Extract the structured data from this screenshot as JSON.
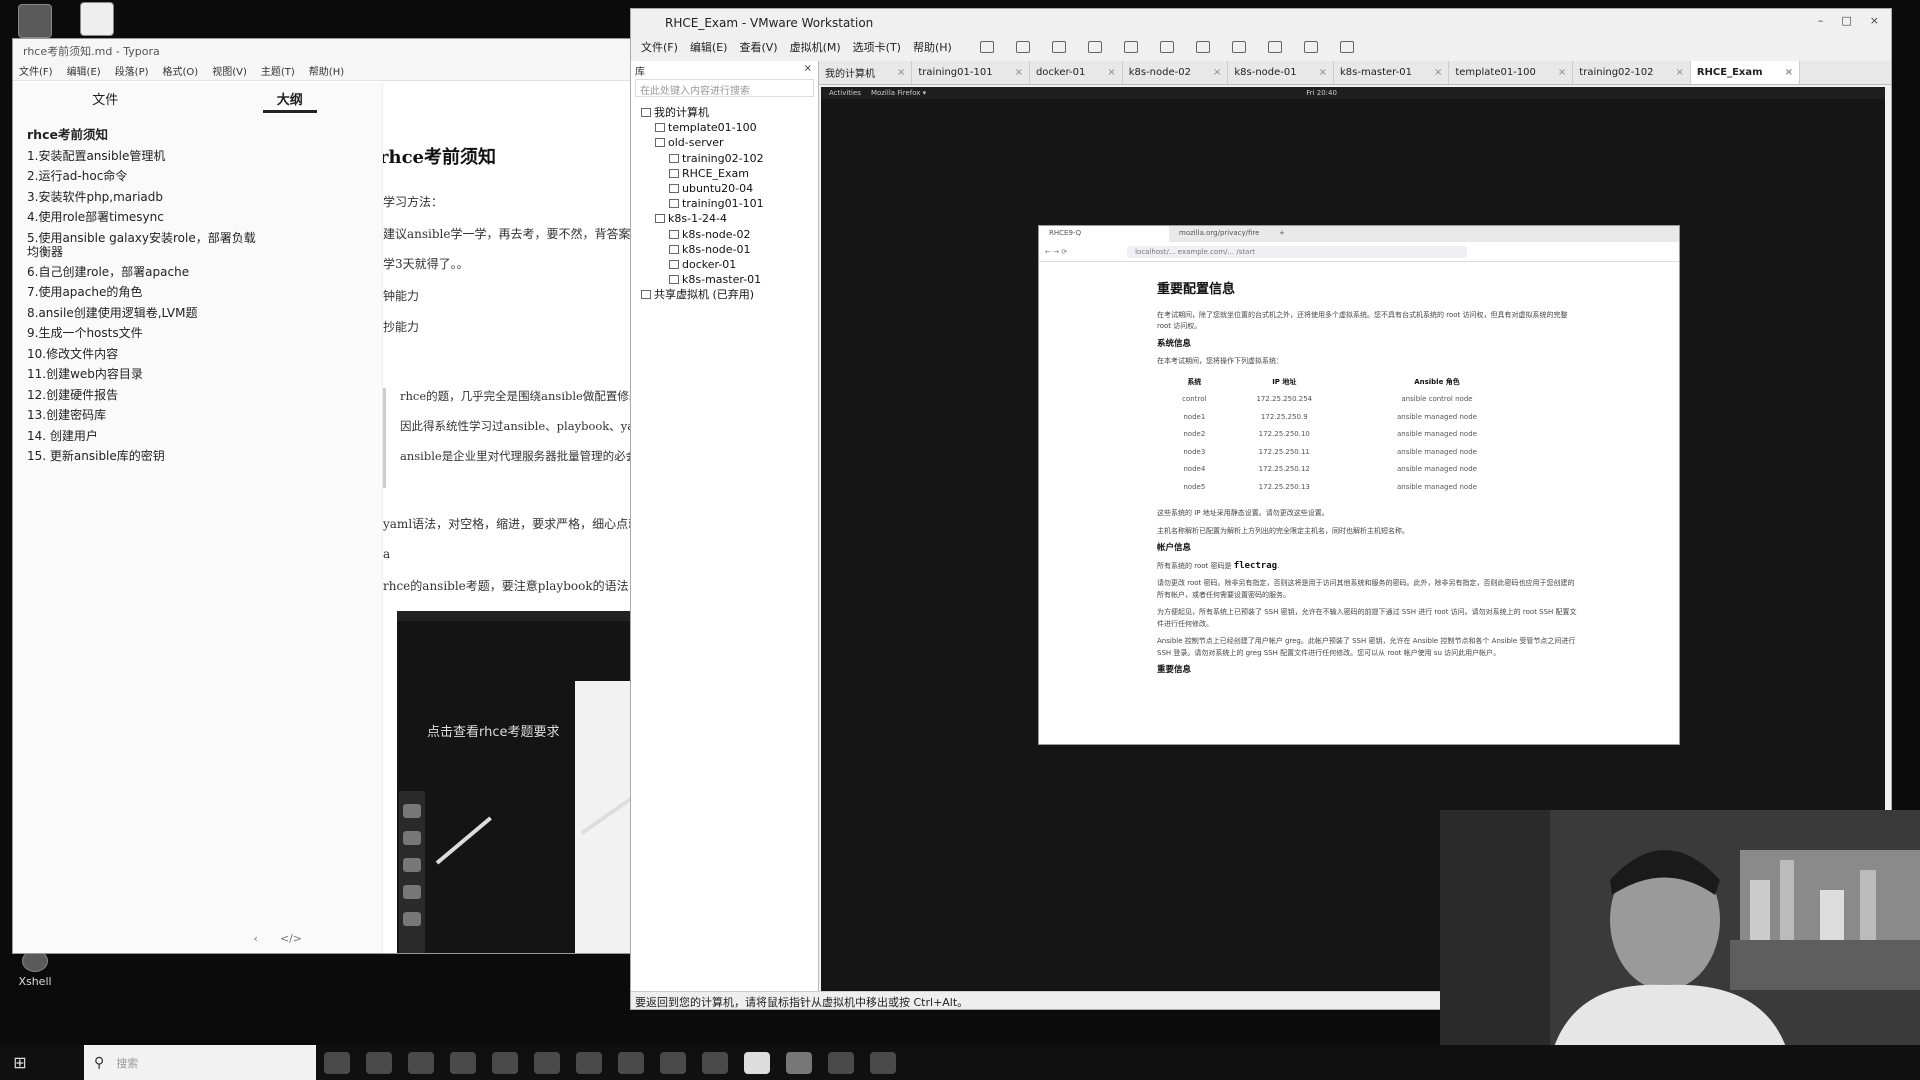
{
  "desktop": {
    "icons": [
      {
        "label": ""
      },
      {
        "label": ""
      },
      {
        "label": "Xshell"
      }
    ]
  },
  "typora": {
    "title": "rhce考前须知.md - Typora",
    "menu": [
      "文件(F)",
      "编辑(E)",
      "段落(P)",
      "格式(O)",
      "视图(V)",
      "主题(T)",
      "帮助(H)"
    ],
    "tabs": {
      "files": "文件",
      "outline": "大纲"
    },
    "outline": [
      "rhce考前须知",
      "1.安装配置ansible管理机",
      "2.运行ad-hoc命令",
      "3.安装软件php,mariadb",
      "4.使用role部署timesync",
      "5.使用ansible galaxy安装role，部署负载均衡器",
      "6.自己创建role，部署apache",
      "7.使用apache的角色",
      "8.ansile创建使用逻辑卷,LVM题",
      "9.生成一个hosts文件",
      "10.修改文件内容",
      "11.创建web内容目录",
      "12.创建硬件报告",
      "13.创建密码库",
      "14. 创建用户",
      "15. 更新ansible库的密钥"
    ],
    "footer": {
      "back": "‹",
      "source": "</>"
    },
    "editor": {
      "title": "rhce考前须知",
      "p1": "学习方法：",
      "p2": "建议ansible学一学，再去考，要不然，背答案，，",
      "p3": "学3天就得了。。",
      "p4": "钟能力",
      "p5": "抄能力",
      "bq1": "rhce的题，几乎完全是围绕ansible做配置修改",
      "bq2": "因此得系统性学习过ansible、playbook、yam",
      "bq3": "ansible是企业里对代理服务器批量管理的必会",
      "p6": "yaml语法，对空格，缩进，要求严格，细心点就",
      "p7": "a",
      "p8": "rhce的ansible考题，要注意playbook的语法，变量",
      "thumb_caption": "点击查看rhce考题要求"
    }
  },
  "vmware": {
    "title": "RHCE_Exam - VMware Workstation",
    "window_controls": [
      "–",
      "□",
      "×"
    ],
    "menu": [
      "文件(F)",
      "编辑(E)",
      "查看(V)",
      "虚拟机(M)",
      "选项卡(T)",
      "帮助(H)"
    ],
    "library": {
      "header": "库",
      "search_placeholder": "在此处键入内容进行搜索",
      "tree": [
        {
          "label": "我的计算机",
          "level": 0
        },
        {
          "label": "template01-100",
          "level": 1
        },
        {
          "label": "old-server",
          "level": 1
        },
        {
          "label": "training02-102",
          "level": 2
        },
        {
          "label": "RHCE_Exam",
          "level": 2
        },
        {
          "label": "ubuntu20-04",
          "level": 2
        },
        {
          "label": "training01-101",
          "level": 2
        },
        {
          "label": "k8s-1-24-4",
          "level": 1
        },
        {
          "label": "k8s-node-02",
          "level": 2
        },
        {
          "label": "k8s-node-01",
          "level": 2
        },
        {
          "label": "docker-01",
          "level": 2
        },
        {
          "label": "k8s-master-01",
          "level": 2
        },
        {
          "label": "共享虚拟机 (已弃用)",
          "level": 0
        }
      ]
    },
    "tabs": [
      "我的计算机",
      "training01-101",
      "docker-01",
      "k8s-node-02",
      "k8s-node-01",
      "k8s-master-01",
      "template01-100",
      "training02-102",
      "RHCE_Exam"
    ],
    "active_tab": "RHCE_Exam",
    "guest_bar": {
      "activities": "Activities",
      "app": "Mozilla Firefox ▾",
      "clock": "Fri 20:40"
    },
    "status": "要返回到您的计算机，请将鼠标指针从虚拟机中移出或按 Ctrl+Alt。"
  },
  "firefox": {
    "tabs": [
      "RHCE9-Q",
      "mozilla.org/privacy/fire",
      "+"
    ],
    "url": "localhost/... example.com/... /start",
    "doc": {
      "title": "重要配置信息",
      "intro": "在考试期间，除了您就坐位置的台式机之外，还将使用多个虚拟系统。您不具有台式机系统的 root 访问权，但具有对虚拟系统的完整 root 访问权。",
      "h_sys": "系统信息",
      "sys_intro": "在本考试期间，您将操作下列虚拟系统：",
      "table_headers": [
        "系统",
        "IP 地址",
        "Ansible 角色"
      ],
      "table_rows": [
        [
          "control",
          "172.25.250.254",
          "ansible control node"
        ],
        [
          "node1",
          "172.25.250.9",
          "ansible managed node"
        ],
        [
          "node2",
          "172.25.250.10",
          "ansible managed node"
        ],
        [
          "node3",
          "172.25.250.11",
          "ansible managed node"
        ],
        [
          "node4",
          "172.25.250.12",
          "ansible managed node"
        ],
        [
          "node5",
          "172.25.250.13",
          "ansible managed node"
        ]
      ],
      "note1": "这些系统的 IP 地址采用静态设置。请勿更改这些设置。",
      "note2": "主机名称解析已配置为解析上方列出的完全限定主机名，同时也解析主机短名称。",
      "h_acct": "帐户信息",
      "acct_prefix": "所有系统的 root 密码是",
      "acct_pw": "flectrag",
      "acct_p1": "请勿更改 root 密码。除非另有指定，否则这将是用于访问其他系统和服务的密码。此外，除非另有指定，否则此密码也应用于您创建的所有帐户，或者任何需要设置密码的服务。",
      "acct_p2": "为方便起见，所有系统上已预装了 SSH 密钥，允许在不输入密码的前提下通过 SSH 进行 root 访问。请勿对系统上的 root SSH 配置文件进行任何修改。",
      "acct_p3": "Ansible 控制节点上已经创建了用户帐户 greg。此帐户预装了 SSH 密钥，允许在 Ansible 控制节点和各个 Ansible 受管节点之间进行 SSH 登录。请勿对系统上的 greg SSH 配置文件进行任何修改。您可以从 root 帐户使用 su 访问此用户帐户。",
      "h_more": "重要信息"
    }
  },
  "taskbar": {
    "start": "⊞",
    "search_placeholder": "搜索"
  }
}
